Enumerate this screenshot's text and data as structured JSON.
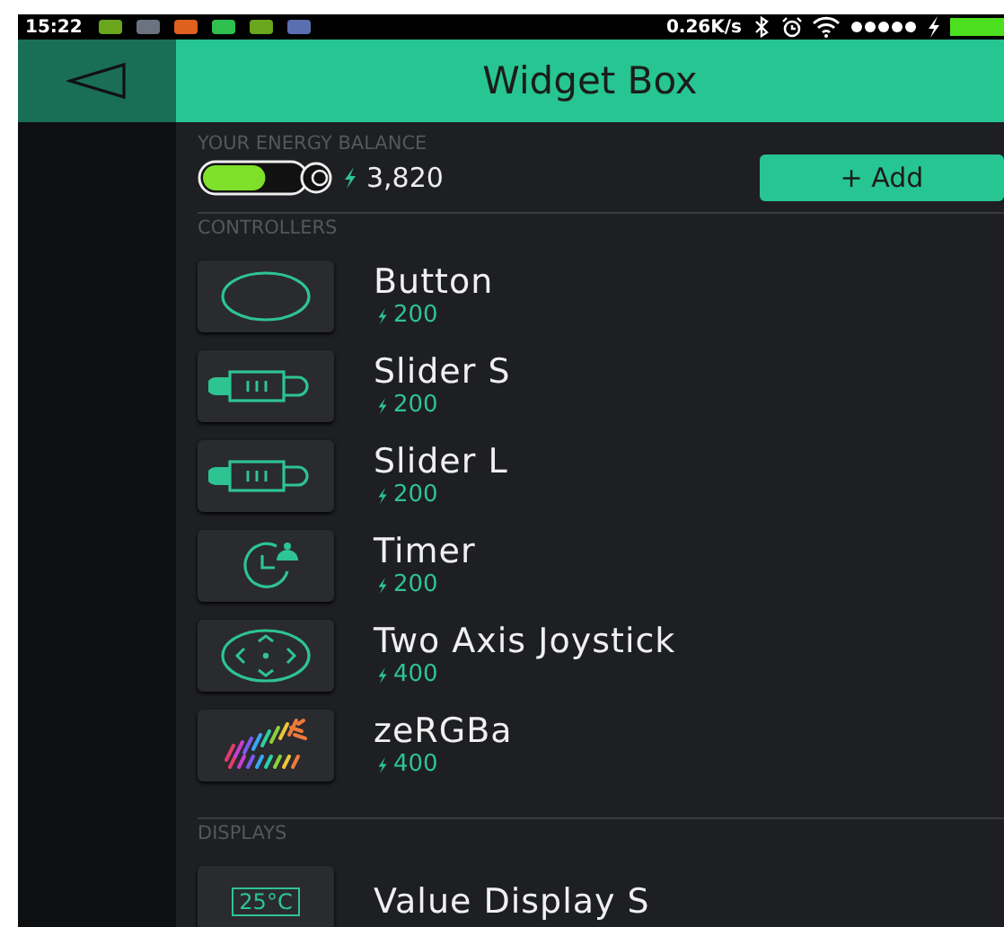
{
  "status_bar": {
    "time": "15:22",
    "notification_icons": [
      {
        "color": "#6aa51e"
      },
      {
        "color": "#6b7280"
      },
      {
        "color": "#e0601e"
      },
      {
        "color": "#2fbf4f"
      },
      {
        "color": "#6aa51e"
      },
      {
        "color": "#5a6fb0"
      }
    ],
    "net_speed": "0.26K/s"
  },
  "header": {
    "title": "Widget Box"
  },
  "energy": {
    "label": "YOUR ENERGY BALANCE",
    "level": 0.62,
    "amount": "3,820",
    "add_button": "+ Add"
  },
  "sections": [
    {
      "title": "CONTROLLERS",
      "widgets": [
        {
          "kind": "button",
          "name": "Button",
          "price": "200"
        },
        {
          "kind": "slider",
          "name": "Slider S",
          "price": "200"
        },
        {
          "kind": "slider",
          "name": "Slider L",
          "price": "200"
        },
        {
          "kind": "timer",
          "name": "Timer",
          "price": "200"
        },
        {
          "kind": "joystick",
          "name": "Two Axis Joystick",
          "price": "400"
        },
        {
          "kind": "zergba",
          "name": "zeRGBa",
          "price": "400"
        }
      ]
    },
    {
      "title": "DISPLAYS",
      "widgets": [
        {
          "kind": "value",
          "name": "Value Display S",
          "icon_text": "25°C"
        }
      ]
    }
  ]
}
